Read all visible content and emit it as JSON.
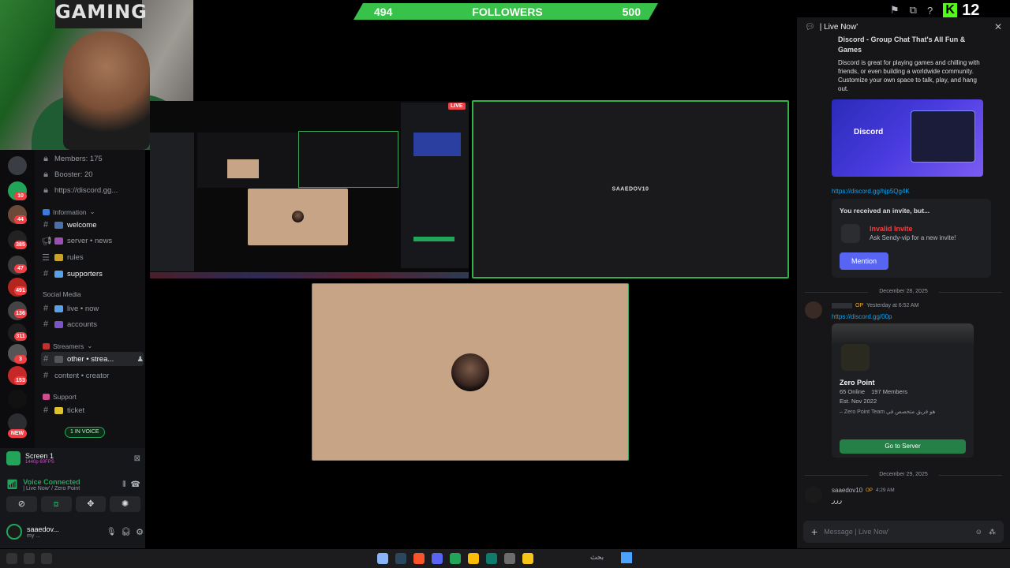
{
  "webcam": {
    "poster_text": "GAMING"
  },
  "follower_goal": {
    "current": "494",
    "label": "FOLLOWERS",
    "target": "500"
  },
  "top_bar": {
    "kick_count": "12"
  },
  "server_badges": [
    "10",
    "44",
    "385",
    "47",
    "491",
    "136",
    "311",
    "3",
    "153",
    "NEW"
  ],
  "server_info": {
    "members": "Members: 175",
    "boosters": "Booster: 20",
    "invite": "https://discord.gg..."
  },
  "categories": {
    "information": "Information",
    "social": "Social Media",
    "streamers": "Streamers",
    "support": "Support"
  },
  "channels": {
    "welcome": "welcome",
    "server_news": "server • news",
    "rules": "rules",
    "supporters": "supporters",
    "live_now": "live • now",
    "accounts": "accounts",
    "other_streamers": "other • strea...",
    "content_creator": "content • creator",
    "ticket": "ticket",
    "in_voice": "1 IN VOICE"
  },
  "screen_share": {
    "title": "Screen 1",
    "quality": "1440p 60FPS"
  },
  "voice": {
    "status": "Voice Connected",
    "location": "| Live Now' / Zero Point"
  },
  "user": {
    "name": "saaedov...",
    "status": "my ..."
  },
  "stream": {
    "watermark": "SAAEDOV10",
    "live_label": "LIVE"
  },
  "chat": {
    "channel": "| Live Now'",
    "embed1": {
      "title": "Discord - Group Chat That's All Fun & Games",
      "desc": "Discord is great for playing games and chilling with friends, or even building a worldwide community. Customize your own space to talk, play, and hang out.",
      "image_label": "Discord"
    },
    "link1": "https://discord.gg/hjp5Qg4K",
    "invite_card": {
      "heading": "You received an invite, but...",
      "invalid_title": "Invalid Invite",
      "invalid_desc": "Ask Sendy-vip for a new invite!",
      "button": "Mention"
    },
    "date1": "December 28, 2025",
    "msg2_time": "Yesterday at 6:52 AM",
    "msg2_link": "https://discord.gg/00p",
    "server_card": {
      "name": "Zero Point",
      "online": "65 Online",
      "members": "197 Members",
      "est": "Est. Nov 2022",
      "desc_line1": "– Zero Point Team هو فريق متخصص في",
      "button": "Go to Server"
    },
    "date2": "December 29, 2025",
    "msg3_author": "saaedov10",
    "msg3_time": "4:29 AM",
    "msg3_text": "ررر",
    "input_placeholder": "Message | Live Now'"
  },
  "taskbar": {
    "search": "بحث"
  }
}
